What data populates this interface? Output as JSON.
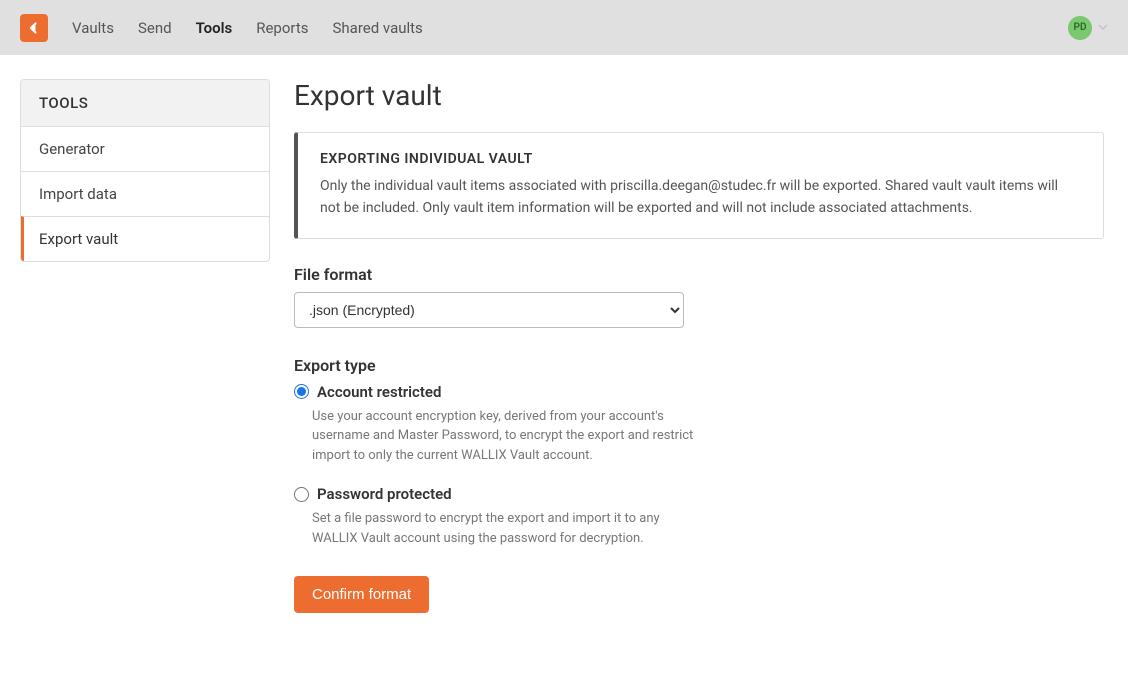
{
  "nav": {
    "items": [
      {
        "label": "Vaults",
        "active": false
      },
      {
        "label": "Send",
        "active": false
      },
      {
        "label": "Tools",
        "active": true
      },
      {
        "label": "Reports",
        "active": false
      },
      {
        "label": "Shared vaults",
        "active": false
      }
    ],
    "avatar_initials": "PD"
  },
  "sidebar": {
    "header": "TOOLS",
    "items": [
      {
        "label": "Generator",
        "active": false
      },
      {
        "label": "Import data",
        "active": false
      },
      {
        "label": "Export vault",
        "active": true
      }
    ]
  },
  "main": {
    "title": "Export vault",
    "callout": {
      "title": "EXPORTING INDIVIDUAL VAULT",
      "body": "Only the individual vault items associated with priscilla.deegan@studec.fr will be exported. Shared vault vault items will not be included. Only vault item information will be exported and will not include associated attachments."
    },
    "file_format": {
      "label": "File format",
      "selected": ".json (Encrypted)"
    },
    "export_type": {
      "label": "Export type",
      "options": [
        {
          "label": "Account restricted",
          "desc": "Use your account encryption key, derived from your account's username and Master Password, to encrypt the export and restrict import to only the current WALLIX Vault account.",
          "checked": true
        },
        {
          "label": "Password protected",
          "desc": "Set a file password to encrypt the export and import it to any WALLIX Vault account using the password for decryption.",
          "checked": false
        }
      ]
    },
    "confirm_button": "Confirm format"
  }
}
